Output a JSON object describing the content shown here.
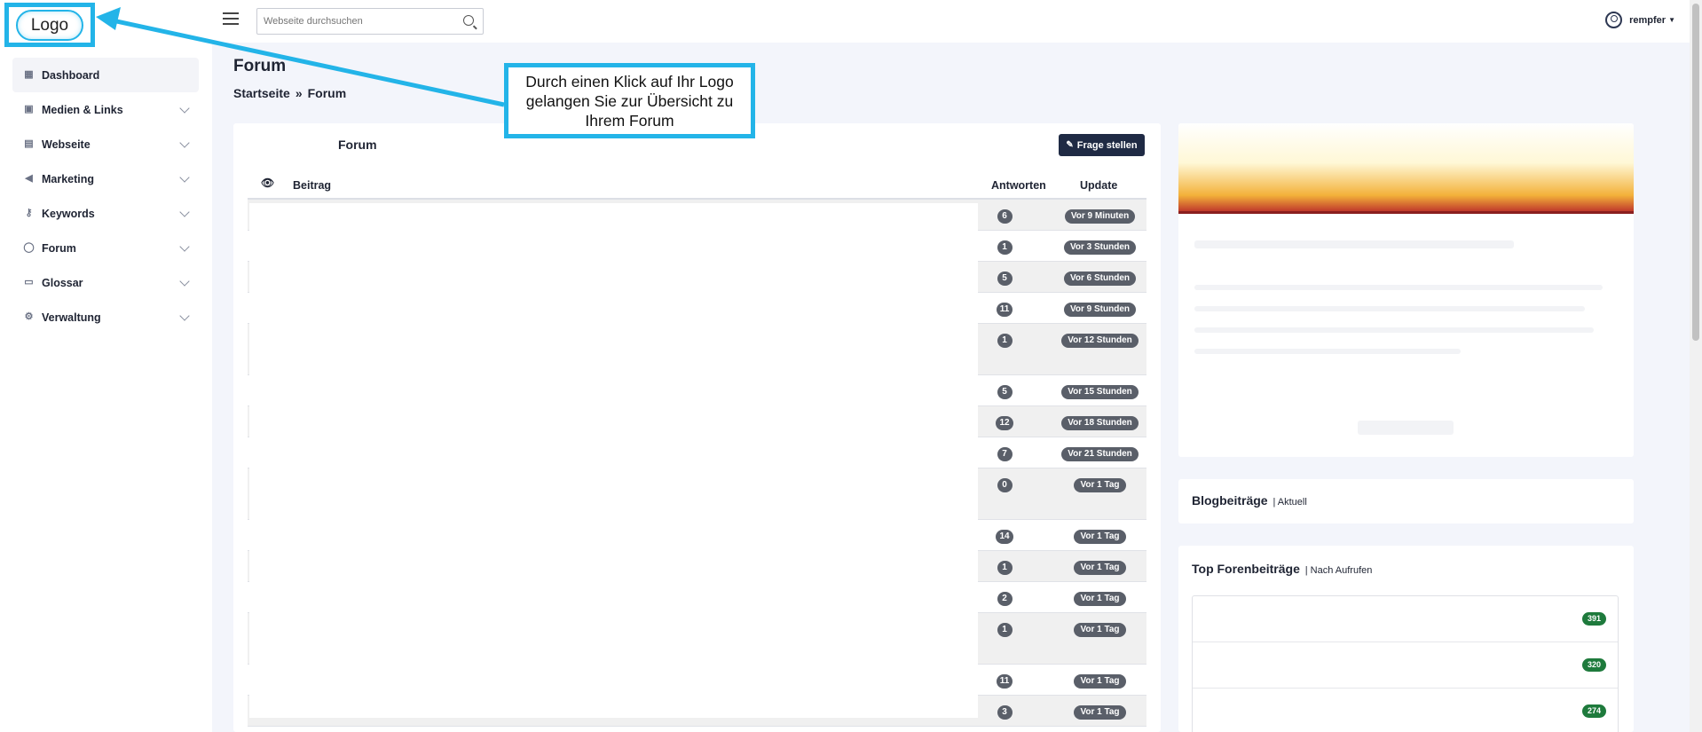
{
  "logo": {
    "text": "Logo"
  },
  "sidebar": {
    "items": [
      {
        "label": "Dashboard",
        "icon": "grid-icon"
      },
      {
        "label": "Medien & Links",
        "icon": "image-icon"
      },
      {
        "label": "Webseite",
        "icon": "page-icon"
      },
      {
        "label": "Marketing",
        "icon": "megaphone-icon"
      },
      {
        "label": "Keywords",
        "icon": "key-icon"
      },
      {
        "label": "Forum",
        "icon": "chat-icon"
      },
      {
        "label": "Glossar",
        "icon": "folder-icon"
      },
      {
        "label": "Verwaltung",
        "icon": "gear-icon"
      }
    ]
  },
  "header": {
    "search_placeholder": "Webseite durchsuchen",
    "username": "rempfer"
  },
  "page": {
    "title": "Forum",
    "breadcrumb": [
      "Startseite",
      "Forum"
    ],
    "breadcrumb_sep": "»"
  },
  "forum": {
    "card_title": "Forum",
    "ask_button": "Frage stellen",
    "columns": {
      "post": "Beitrag",
      "answers": "Antworten",
      "update": "Update"
    },
    "rows": [
      {
        "answers": "6",
        "update": "Vor 9 Minuten",
        "tall": false
      },
      {
        "answers": "1",
        "update": "Vor 3 Stunden",
        "tall": false
      },
      {
        "answers": "5",
        "update": "Vor 6 Stunden",
        "tall": false
      },
      {
        "answers": "11",
        "update": "Vor 9 Stunden",
        "tall": false
      },
      {
        "answers": "1",
        "update": "Vor 12 Stunden",
        "tall": true
      },
      {
        "answers": "5",
        "update": "Vor 15 Stunden",
        "tall": false
      },
      {
        "answers": "12",
        "update": "Vor 18 Stunden",
        "tall": false
      },
      {
        "answers": "7",
        "update": "Vor 21 Stunden",
        "tall": false
      },
      {
        "answers": "0",
        "update": "Vor 1 Tag",
        "tall": true
      },
      {
        "answers": "14",
        "update": "Vor 1 Tag",
        "tall": false
      },
      {
        "answers": "1",
        "update": "Vor 1 Tag",
        "tall": false
      },
      {
        "answers": "2",
        "update": "Vor 1 Tag",
        "tall": false
      },
      {
        "answers": "1",
        "update": "Vor 1 Tag",
        "tall": true
      },
      {
        "answers": "11",
        "update": "Vor 1 Tag",
        "tall": false
      },
      {
        "answers": "3",
        "update": "Vor 1 Tag",
        "tall": false
      }
    ]
  },
  "blog": {
    "title": "Blogbeiträge",
    "subtitle": "| Aktuell"
  },
  "top_posts": {
    "title": "Top Forenbeiträge",
    "subtitle": "| Nach Aufrufen",
    "views": [
      "391",
      "320",
      "274"
    ]
  },
  "callout": {
    "text": "Durch einen Klick auf Ihr Logo gelangen Sie zur Übersicht zu Ihrem Forum"
  },
  "colors": {
    "accent": "#23b4e8",
    "navy": "#1f2a44",
    "badge_gray": "#5a5f69",
    "badge_green": "#1e7a3c"
  }
}
